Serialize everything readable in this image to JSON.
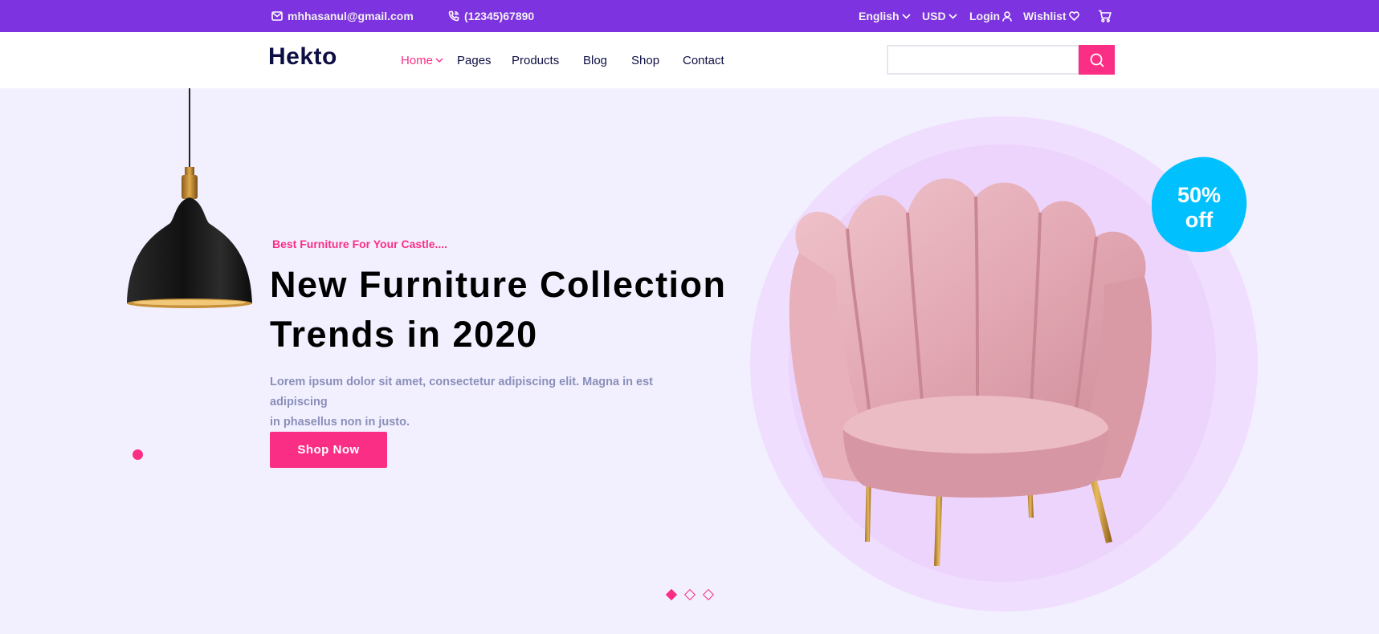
{
  "topbar": {
    "email": "mhhasanul@gmail.com",
    "phone": "(12345)67890",
    "language": "English",
    "currency": "USD",
    "login": "Login",
    "wishlist": "Wishlist",
    "icons": [
      "mail-icon",
      "phone-icon",
      "chevron-down-icon",
      "user-icon",
      "heart-icon",
      "cart-icon"
    ]
  },
  "navbar": {
    "logo": "Hekto",
    "links": [
      "Home",
      "Pages",
      "Products",
      "Blog",
      "Shop",
      "Contact"
    ],
    "active_link": "Home",
    "search_value": ""
  },
  "hero": {
    "subtitle": "Best Furniture For Your Castle....",
    "title_line1": "New Furniture Collection",
    "title_line2": "Trends in 2020",
    "description_line1": "Lorem ipsum dolor sit amet, consectetur adipiscing elit. Magna in est adipiscing",
    "description_line2": "in phasellus non in justo.",
    "cta": "Shop Now",
    "discount_line1": "50%",
    "discount_line2": "off",
    "slides_total": 3,
    "active_slide": 1
  },
  "colors": {
    "topbar": "#7E33E0",
    "accent": "#FB2E86",
    "navy": "#0D0E43",
    "hero_bg": "#F2F0FF",
    "badge": "#00C1FE",
    "muted_text": "#8A8FB9"
  }
}
